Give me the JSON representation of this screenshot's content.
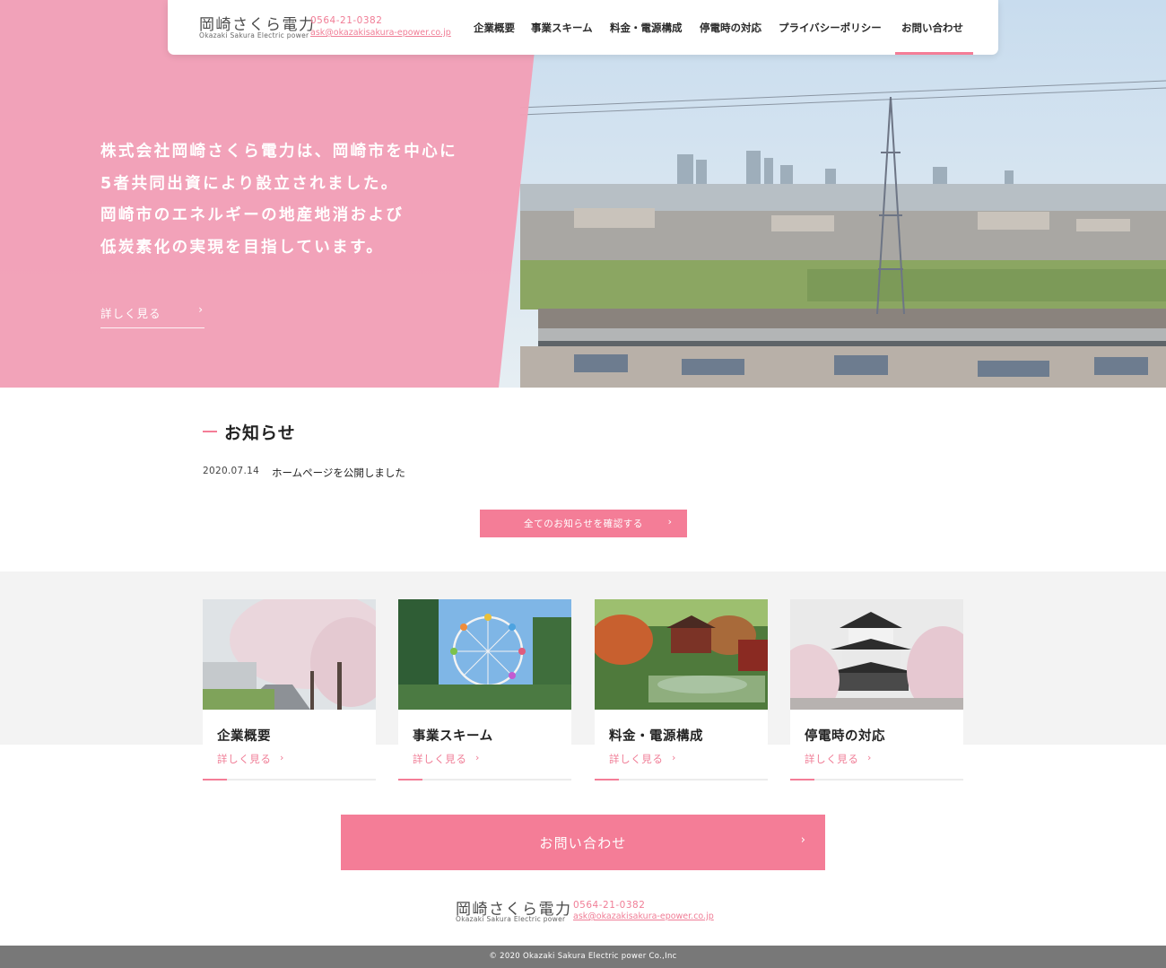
{
  "colors": {
    "accent": "#f47d97",
    "hero_pink": "#f29fb6",
    "footer_gray": "#787878",
    "band_gray": "#f3f3f3"
  },
  "header": {
    "logo_jp": "岡崎さくら電力",
    "logo_en": "Okazaki Sakura Electric power",
    "tel": "0564-21-0382",
    "email": "ask@okazakisakura-epower.co.jp",
    "nav": [
      "企業概要",
      "事業スキーム",
      "料金・電源構成",
      "停電時の対応",
      "プライバシーポリシー",
      "お問い合わせ"
    ],
    "active_nav": "お問い合わせ"
  },
  "hero": {
    "lines": [
      "株式会社岡崎さくら電力は、岡崎市を中心に",
      "5者共同出資により設立されました。",
      "岡崎市のエネルギーの地産地消および",
      "低炭素化の実現を目指しています。"
    ],
    "more_label": "詳しく見る",
    "chevron": "›"
  },
  "news": {
    "title": "お知らせ",
    "items": [
      {
        "date": "2020.07.14",
        "text": "ホームページを公開しました"
      }
    ],
    "all_button": "全てのお知らせを確認する",
    "chevron": "›"
  },
  "cards": [
    {
      "title": "企業概要",
      "more": "詳しく見る",
      "chevron": "›",
      "image": "cherry-blossom-road"
    },
    {
      "title": "事業スキーム",
      "more": "詳しく見る",
      "chevron": "›",
      "image": "ferris-wheel"
    },
    {
      "title": "料金・電源構成",
      "more": "詳しく見る",
      "chevron": "›",
      "image": "japanese-garden"
    },
    {
      "title": "停電時の対応",
      "more": "詳しく見る",
      "chevron": "›",
      "image": "castle-with-blossoms"
    }
  ],
  "contact": {
    "label": "お問い合わせ",
    "chevron": "›"
  },
  "footer": {
    "logo_jp": "岡崎さくら電力",
    "logo_en": "Okazaki Sakura Electric power",
    "tel": "0564-21-0382",
    "email": "ask@okazakisakura-epower.co.jp",
    "copyright": "© 2020 Okazaki Sakura Electric power Co.,Inc"
  }
}
